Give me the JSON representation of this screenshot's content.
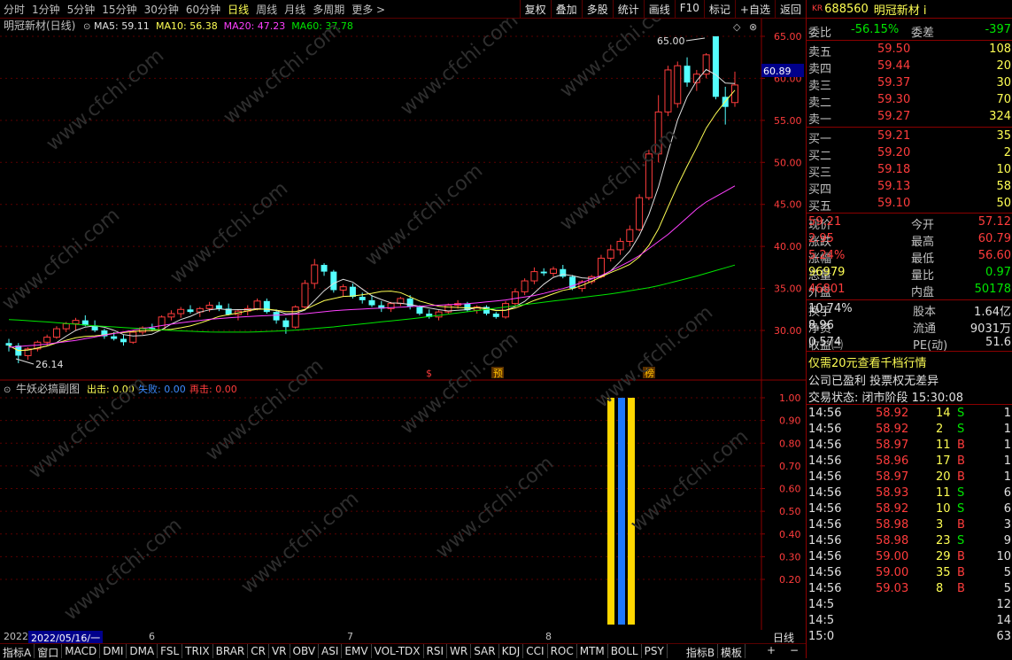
{
  "toolbar": {
    "periods": [
      "分时",
      "1分钟",
      "5分钟",
      "15分钟",
      "30分钟",
      "60分钟",
      "日线",
      "周线",
      "月线",
      "多周期",
      "更多 >"
    ],
    "active_period": "日线",
    "tools": [
      "复权",
      "叠加",
      "多股",
      "统计",
      "画线",
      "F10",
      "标记",
      "+自选",
      "返回"
    ]
  },
  "main_chart": {
    "title": "明冠新材(日线)",
    "ma_labels": [
      {
        "text": "MA5: 59.11",
        "color": "#e0e0e0"
      },
      {
        "text": "MA10: 56.38",
        "color": "#ffff54"
      },
      {
        "text": "MA20: 47.23",
        "color": "#ff40ff"
      },
      {
        "text": "MA60: 37.78",
        "color": "#00e600"
      }
    ],
    "price_axis": [
      "65.00",
      "60.00",
      "55.00",
      "50.00",
      "45.00",
      "40.00",
      "35.00",
      "30.00"
    ],
    "current_price_tag": "60.89",
    "high_label": "65.00",
    "low_label": "26.14",
    "markers": [
      {
        "text": "$",
        "color": "#ff3c3c"
      },
      {
        "text": "预",
        "color": "#ffc000"
      },
      {
        "text": "榜",
        "color": "#ffc000"
      }
    ]
  },
  "sub_chart": {
    "title": "牛妖必搞副图",
    "labels": [
      {
        "text": "出击: 0.00",
        "color": "#ffff54"
      },
      {
        "text": "失败: 0.00",
        "color": "#3c8cff"
      },
      {
        "text": "再击: 0.00",
        "color": "#ff3c3c"
      }
    ],
    "axis": [
      "1.00",
      "0.90",
      "0.80",
      "0.70",
      "0.60",
      "0.50",
      "0.40",
      "0.30",
      "0.20"
    ]
  },
  "date_axis": {
    "year": "2022",
    "cursor": "2022/05/16/一",
    "months": [
      "6",
      "7",
      "8"
    ],
    "period_label": "日线",
    "plus": "+",
    "minus": "−"
  },
  "bottom_tabs": [
    "指标A",
    "窗口",
    "MACD",
    "DMI",
    "DMA",
    "FSL",
    "TRIX",
    "BRAR",
    "CR",
    "VR",
    "OBV",
    "ASI",
    "EMV",
    "VOL-TDX",
    "RSI",
    "WR",
    "SAR",
    "KDJ",
    "CCI",
    "ROC",
    "MTM",
    "BOLL",
    "PSY",
    "指标B",
    "模板"
  ],
  "quote": {
    "kr": "KR",
    "code": "688560",
    "name": "明冠新材 i",
    "weibi_label": "委比",
    "weibi": "-56.15%",
    "weicha_label": "委差",
    "weicha": "-397",
    "asks": [
      {
        "label": "卖五",
        "price": "59.50",
        "vol": "108"
      },
      {
        "label": "卖四",
        "price": "59.44",
        "vol": "20"
      },
      {
        "label": "卖三",
        "price": "59.37",
        "vol": "30"
      },
      {
        "label": "卖二",
        "price": "59.30",
        "vol": "70"
      },
      {
        "label": "卖一",
        "price": "59.27",
        "vol": "324"
      }
    ],
    "bids": [
      {
        "label": "买一",
        "price": "59.21",
        "vol": "35"
      },
      {
        "label": "买二",
        "price": "59.20",
        "vol": "2"
      },
      {
        "label": "买三",
        "price": "59.18",
        "vol": "10"
      },
      {
        "label": "买四",
        "price": "59.13",
        "vol": "58"
      },
      {
        "label": "买五",
        "price": "59.10",
        "vol": "50"
      }
    ],
    "stats": [
      {
        "l1": "现价",
        "v1": "59.21",
        "c1": "#ff3c3c",
        "l2": "今开",
        "v2": "57.12",
        "c2": "#ff3c3c"
      },
      {
        "l1": "涨跌",
        "v1": "2.95",
        "c1": "#ff3c3c",
        "l2": "最高",
        "v2": "60.79",
        "c2": "#ff3c3c"
      },
      {
        "l1": "涨幅",
        "v1": "5.24%",
        "c1": "#ff3c3c",
        "l2": "最低",
        "v2": "56.60",
        "c2": "#ff3c3c"
      },
      {
        "l1": "总量",
        "v1": "96979",
        "c1": "#ffff54",
        "l2": "量比",
        "v2": "0.97",
        "c2": "#00e600"
      },
      {
        "l1": "外盘",
        "v1": "46801",
        "c1": "#ff3c3c",
        "l2": "内盘",
        "v2": "50178",
        "c2": "#00e600"
      }
    ],
    "stats2": [
      {
        "l1": "换手",
        "v1": "10.74%",
        "l2": "股本",
        "v2": "1.64亿"
      },
      {
        "l1": "净资",
        "v1": "8.96",
        "l2": "流通",
        "v2": "9031万"
      },
      {
        "l1": "收益㈡",
        "v1": "0.574",
        "l2": "PE(动)",
        "v2": "51.6"
      }
    ],
    "promo": "仅需20元查看千档行情",
    "notice": "公司已盈利 投票权无差异",
    "trade_status": "交易状态: 闭市阶段 15:30:08",
    "ticks": [
      {
        "t": "14:56",
        "p": "58.92",
        "v": "14",
        "s": "S",
        "n": "1"
      },
      {
        "t": "14:56",
        "p": "58.92",
        "v": "2",
        "s": "S",
        "n": "1"
      },
      {
        "t": "14:56",
        "p": "58.97",
        "v": "11",
        "s": "B",
        "n": "1"
      },
      {
        "t": "14:56",
        "p": "58.96",
        "v": "17",
        "s": "B",
        "n": "1"
      },
      {
        "t": "14:56",
        "p": "58.97",
        "v": "20",
        "s": "B",
        "n": "1"
      },
      {
        "t": "14:56",
        "p": "58.93",
        "v": "11",
        "s": "S",
        "n": "6"
      },
      {
        "t": "14:56",
        "p": "58.92",
        "v": "10",
        "s": "S",
        "n": "6"
      },
      {
        "t": "14:56",
        "p": "58.98",
        "v": "3",
        "s": "B",
        "n": "3"
      },
      {
        "t": "14:56",
        "p": "58.98",
        "v": "23",
        "s": "S",
        "n": "9"
      },
      {
        "t": "14:56",
        "p": "59.00",
        "v": "29",
        "s": "B",
        "n": "10"
      },
      {
        "t": "14:56",
        "p": "59.00",
        "v": "35",
        "s": "B",
        "n": "5"
      },
      {
        "t": "14:56",
        "p": "59.03",
        "v": "8",
        "s": "B",
        "n": "5"
      },
      {
        "t": "14:5",
        "p": "",
        "v": "",
        "s": "",
        "n": "12"
      },
      {
        "t": "14:5",
        "p": "",
        "v": "",
        "s": "",
        "n": "14"
      },
      {
        "t": "15:0",
        "p": "",
        "v": "",
        "s": "",
        "n": "63"
      }
    ]
  },
  "watermark": "www.cfchi.com",
  "colors": {
    "up": "#ff3c3c",
    "down": "#54ffff",
    "grid": "#8b0000"
  }
}
